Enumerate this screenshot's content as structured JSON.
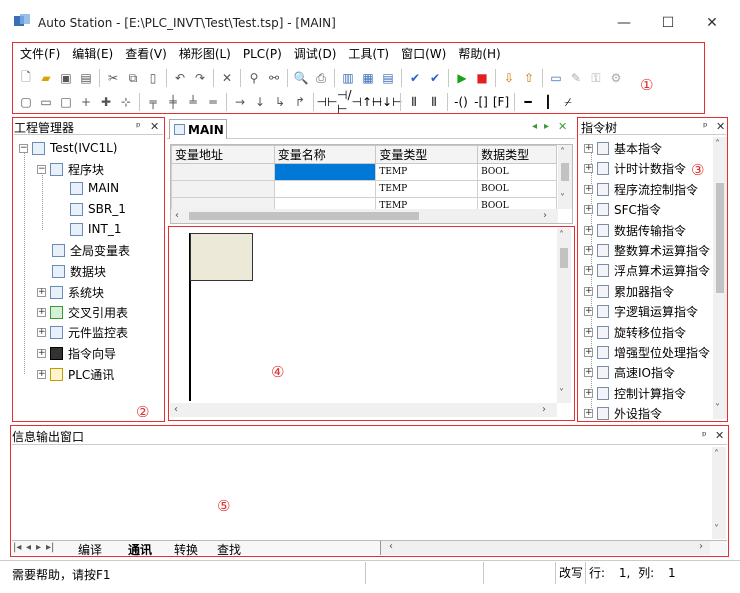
{
  "window": {
    "title": "Auto Station - [E:\\PLC_INVT\\Test\\Test.tsp] - [MAIN]",
    "minimize": "—",
    "maximize": "☐",
    "close": "✕"
  },
  "menu": [
    "文件(F)",
    "编辑(E)",
    "查看(V)",
    "梯形图(L)",
    "PLC(P)",
    "调试(D)",
    "工具(T)",
    "窗口(W)",
    "帮助(H)"
  ],
  "markers": {
    "m1": "①",
    "m2": "②",
    "m3": "③",
    "m4": "④",
    "m5": "⑤"
  },
  "project_manager": {
    "title": "工程管理器",
    "pin": "ᵖ",
    "close": "✕",
    "tree": [
      {
        "label": "Test(IVC1L)",
        "exp": "−"
      },
      {
        "label": "程序块",
        "exp": "−"
      },
      {
        "label": "MAIN"
      },
      {
        "label": "SBR_1"
      },
      {
        "label": "INT_1"
      },
      {
        "label": "全局变量表"
      },
      {
        "label": "数据块"
      },
      {
        "label": "系统块",
        "exp": "+"
      },
      {
        "label": "交叉引用表",
        "exp": "+"
      },
      {
        "label": "元件监控表",
        "exp": "+"
      },
      {
        "label": "指令向导",
        "exp": "+"
      },
      {
        "label": "PLC通讯",
        "exp": "+"
      }
    ]
  },
  "editor": {
    "tab": "MAIN",
    "columns": [
      "变量地址",
      "变量名称",
      "变量类型",
      "数据类型"
    ],
    "rows": [
      [
        "",
        "",
        "TEMP",
        "BOOL"
      ],
      [
        "",
        "",
        "TEMP",
        "BOOL"
      ],
      [
        "",
        "",
        "TEMP",
        "BOOL"
      ]
    ]
  },
  "instruction_tree": {
    "title": "指令树",
    "items": [
      "基本指令",
      "计时计数指令",
      "程序流控制指令",
      "SFC指令",
      "数据传输指令",
      "整数算术运算指令",
      "浮点算术运算指令",
      "累加器指令",
      "字逻辑运算指令",
      "旋转移位指令",
      "增强型位处理指令",
      "高速IO指令",
      "控制计算指令",
      "外设指令"
    ]
  },
  "output": {
    "title": "信息输出窗口",
    "tabs": [
      "编译",
      "通讯",
      "转换",
      "查找"
    ],
    "nav": [
      "|◂",
      "◂",
      "▸",
      "▸|"
    ]
  },
  "status": {
    "help": "需要帮助，请按F1",
    "mode": "改写",
    "row_label": "行:",
    "row": "1,",
    "col_label": "列:",
    "col": "1"
  },
  "colors": {
    "accent": "#e03030",
    "selection": "#0078d7",
    "ladder_cell": "#ece9d8"
  }
}
